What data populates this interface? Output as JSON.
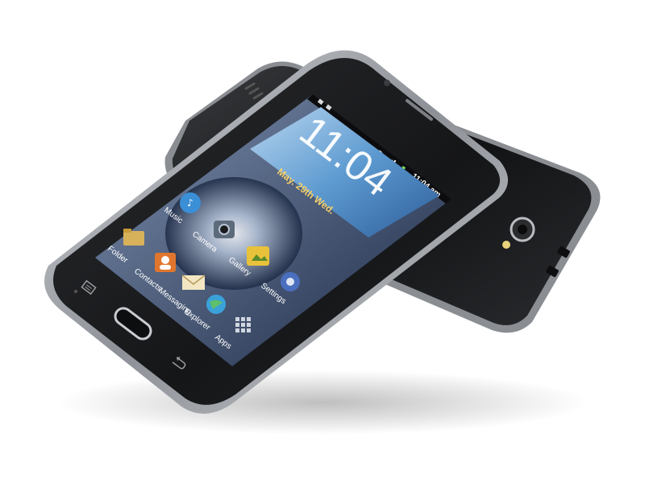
{
  "scene": {
    "subject": "Two smartphones, one lying on top of the other",
    "background_color": "#ffffff"
  },
  "front_phone": {
    "status_bar": {
      "time": "11:04 am",
      "icons": [
        "usb-icon",
        "sim-icon",
        "wifi-icon",
        "signal-icon",
        "battery-icon"
      ]
    },
    "clock_widget": {
      "time": "11:04",
      "date": "May. 29th Wed."
    },
    "home_icons": [
      {
        "label": "Music",
        "icon": "music-icon",
        "color": "#3a8fd6"
      },
      {
        "label": "Camera",
        "icon": "camera-icon",
        "color": "#5c6a7a"
      },
      {
        "label": "Folder",
        "icon": "folder-icon",
        "color": "#d7b25a"
      },
      {
        "label": "Contacts",
        "icon": "contacts-icon",
        "color": "#e0762d"
      },
      {
        "label": "Gallery",
        "icon": "gallery-icon",
        "color": "#e8c23a"
      },
      {
        "label": "Messaging",
        "icon": "messaging-icon",
        "color": "#f2e6c3"
      },
      {
        "label": "Settings",
        "icon": "settings-icon",
        "color": "#4a6fbf"
      },
      {
        "label": "Explorer",
        "icon": "globe-icon",
        "color": "#3aa1d9"
      },
      {
        "label": "Apps",
        "icon": "apps-grid-icon",
        "color": "#cfd6e0"
      }
    ],
    "buttons": [
      "menu-key-icon",
      "home-button",
      "back-key-icon"
    ]
  },
  "back_phone": {
    "visible_parts": [
      "camera-lens",
      "flash",
      "speaker-grille",
      "side-buttons"
    ]
  },
  "colors": {
    "phone_body": "#1b1c1e",
    "bezel": "#a3a7ad",
    "screen_sky": "#6fa8d8",
    "wallpaper_dark": "#1d2a45"
  }
}
